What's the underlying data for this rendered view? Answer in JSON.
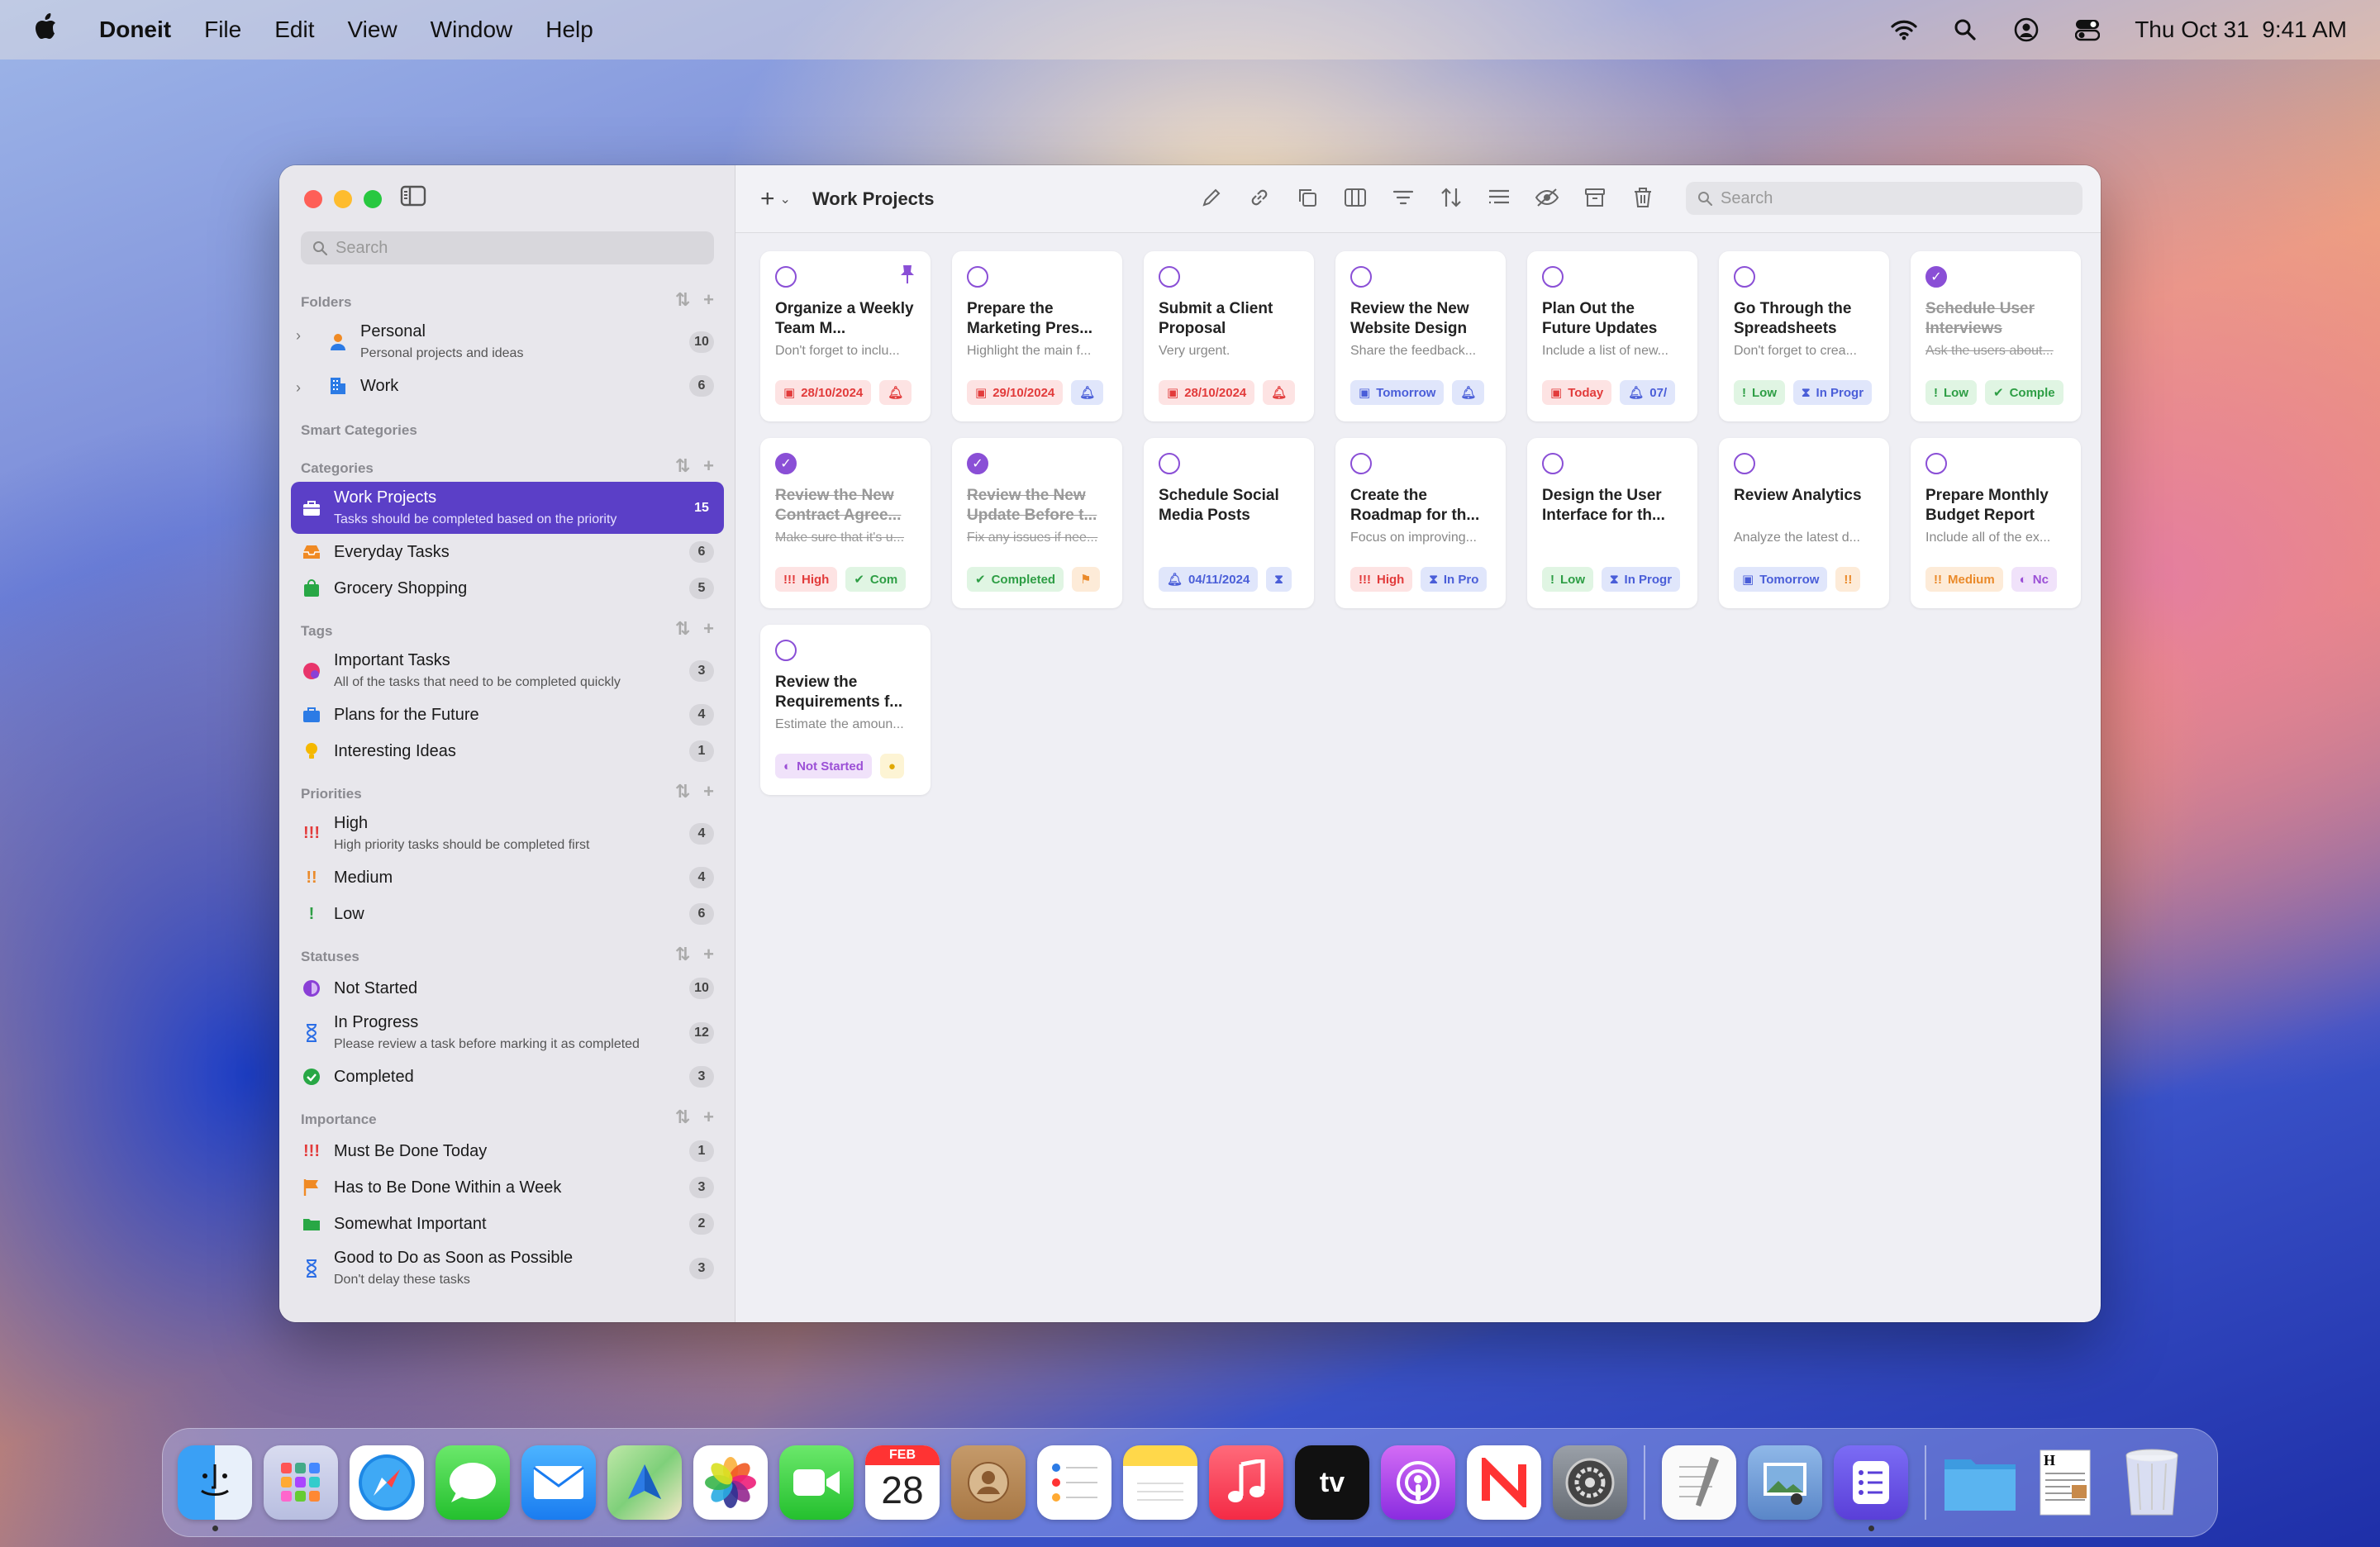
{
  "menubar": {
    "app": "Doneit",
    "items": [
      "File",
      "Edit",
      "View",
      "Window",
      "Help"
    ],
    "datetime": "Thu Oct 31  9:41 AM"
  },
  "sidebar": {
    "search_placeholder": "Search",
    "folders": {
      "title": "Folders",
      "items": [
        {
          "label": "Personal",
          "desc": "Personal projects and ideas",
          "count": "10"
        },
        {
          "label": "Work",
          "count": "6"
        }
      ]
    },
    "smart_categories": {
      "title": "Smart Categories"
    },
    "categories": {
      "title": "Categories",
      "items": [
        {
          "label": "Work Projects",
          "desc": "Tasks should be completed based on the priority",
          "count": "15"
        },
        {
          "label": "Everyday Tasks",
          "count": "6"
        },
        {
          "label": "Grocery Shopping",
          "count": "5"
        }
      ]
    },
    "tags": {
      "title": "Tags",
      "items": [
        {
          "label": "Important Tasks",
          "desc": "All of the tasks that need to be completed quickly",
          "count": "3"
        },
        {
          "label": "Plans for the Future",
          "count": "4"
        },
        {
          "label": "Interesting Ideas",
          "count": "1"
        }
      ]
    },
    "priorities": {
      "title": "Priorities",
      "items": [
        {
          "label": "High",
          "desc": "High priority tasks should be completed first",
          "count": "4"
        },
        {
          "label": "Medium",
          "count": "4"
        },
        {
          "label": "Low",
          "count": "6"
        }
      ]
    },
    "statuses": {
      "title": "Statuses",
      "items": [
        {
          "label": "Not Started",
          "count": "10"
        },
        {
          "label": "In Progress",
          "desc": "Please review a task before marking it as completed",
          "count": "12"
        },
        {
          "label": "Completed",
          "count": "3"
        }
      ]
    },
    "importance": {
      "title": "Importance",
      "items": [
        {
          "label": "Must Be Done Today",
          "count": "1"
        },
        {
          "label": "Has to Be Done Within a Week",
          "count": "3"
        },
        {
          "label": "Somewhat Important",
          "count": "2"
        },
        {
          "label": "Good to Do as Soon as Possible",
          "desc": "Don't delay these tasks",
          "count": "3"
        }
      ]
    }
  },
  "main": {
    "title": "Work Projects",
    "search_placeholder": "Search",
    "cards": [
      {
        "title": "Organize a Weekly Team M...",
        "sub": "Don't forget to inclu...",
        "tag1": "28/10/2024",
        "tag2": ""
      },
      {
        "title": "Prepare the Marketing Pres...",
        "sub": "Highlight the main f...",
        "tag1": "29/10/2024",
        "tag2": ""
      },
      {
        "title": "Submit a Client Proposal",
        "sub": "Very urgent.",
        "tag1": "28/10/2024",
        "tag2": ""
      },
      {
        "title": "Review the New Website Design",
        "sub": "Share the feedback...",
        "tag1": "Tomorrow",
        "tag2": ""
      },
      {
        "title": "Plan Out the Future Updates",
        "sub": "Include a list of new...",
        "tag1": "Today",
        "tag2": "07/"
      },
      {
        "title": "Go Through the Spreadsheets",
        "sub": "Don't forget to crea...",
        "tag1": "Low",
        "tag2": "In Progr"
      },
      {
        "title": "Schedule User Interviews",
        "sub": "Ask the users about...",
        "tag1": "Low",
        "tag2": "Comple"
      },
      {
        "title": "Review the New Contract Agree...",
        "sub": "Make sure that it's u...",
        "tag1": "High",
        "tag2": "Com"
      },
      {
        "title": "Review the New Update Before t...",
        "sub": "Fix any issues if nee...",
        "tag1": "Completed",
        "tag2": ""
      },
      {
        "title": "Schedule Social Media Posts",
        "sub": "",
        "tag1": "04/11/2024",
        "tag2": ""
      },
      {
        "title": "Create the Roadmap for th...",
        "sub": "Focus on improving...",
        "tag1": "High",
        "tag2": "In Pro"
      },
      {
        "title": "Design the User Interface for th...",
        "sub": "",
        "tag1": "Low",
        "tag2": "In Progr"
      },
      {
        "title": "Review Analytics",
        "sub": "Analyze the latest d...",
        "tag1": "Tomorrow",
        "tag2": ""
      },
      {
        "title": "Prepare Monthly Budget Report",
        "sub": "Include all of the ex...",
        "tag1": "Medium",
        "tag2": "Nc"
      },
      {
        "title": "Review the Requirements f...",
        "sub": "Estimate the amoun...",
        "tag1": "Not Started",
        "tag2": ""
      }
    ]
  },
  "dock": {
    "calendar_month": "FEB",
    "calendar_day": "28",
    "tv_label": "tv"
  }
}
